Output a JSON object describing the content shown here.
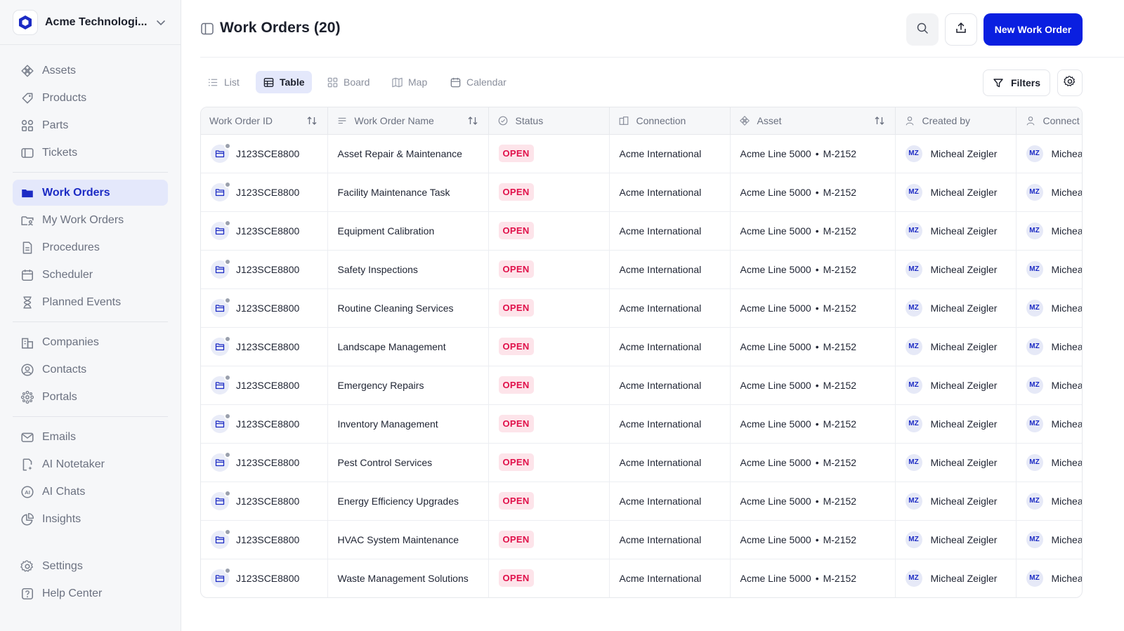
{
  "workspace": {
    "name": "Acme Technologi..."
  },
  "sidebar": {
    "groups": [
      [
        {
          "label": "Assets",
          "icon": "assets-icon"
        },
        {
          "label": "Products",
          "icon": "tag-icon"
        },
        {
          "label": "Parts",
          "icon": "parts-icon"
        },
        {
          "label": "Tickets",
          "icon": "ticket-icon"
        }
      ],
      [
        {
          "label": "Work Orders",
          "icon": "folder-icon",
          "active": true
        },
        {
          "label": "My Work Orders",
          "icon": "user-folder-icon"
        },
        {
          "label": "Procedures",
          "icon": "document-icon"
        },
        {
          "label": "Scheduler",
          "icon": "calendar-icon"
        },
        {
          "label": "Planned Events",
          "icon": "hourglass-icon"
        }
      ],
      [
        {
          "label": "Companies",
          "icon": "building-icon"
        },
        {
          "label": "Contacts",
          "icon": "contact-icon"
        },
        {
          "label": "Portals",
          "icon": "portal-icon"
        }
      ],
      [
        {
          "label": "Emails",
          "icon": "mail-icon"
        },
        {
          "label": "AI Notetaker",
          "icon": "notetaker-icon"
        },
        {
          "label": "AI Chats",
          "icon": "ai-chat-icon"
        },
        {
          "label": "Insights",
          "icon": "pie-chart-icon"
        }
      ],
      [
        {
          "label": "Settings",
          "icon": "gear-icon"
        },
        {
          "label": "Help Center",
          "icon": "help-icon"
        }
      ]
    ]
  },
  "header": {
    "title": "Work Orders (20)",
    "new_button": "New Work Order"
  },
  "views": {
    "tabs": [
      {
        "label": "List",
        "icon": "list-icon"
      },
      {
        "label": "Table",
        "icon": "table-icon",
        "active": true
      },
      {
        "label": "Board",
        "icon": "board-icon"
      },
      {
        "label": "Map",
        "icon": "map-icon"
      },
      {
        "label": "Calendar",
        "icon": "calendar-icon"
      }
    ],
    "filters_label": "Filters"
  },
  "table": {
    "columns": [
      {
        "label": "Work Order ID"
      },
      {
        "label": "Work Order Name"
      },
      {
        "label": "Status"
      },
      {
        "label": "Connection"
      },
      {
        "label": "Asset"
      },
      {
        "label": "Created by"
      },
      {
        "label": "Connect"
      }
    ],
    "rows": [
      {
        "id": "J123SCE8800",
        "name": "Asset Repair & Maintenance",
        "status": "OPEN",
        "connection": "Acme International",
        "asset": "Acme Line 5000",
        "asset_code": "M-2152",
        "creator_initials": "MZ",
        "creator": "Micheal Zeigler",
        "contact_initials": "MZ",
        "contact": "Michea"
      },
      {
        "id": "J123SCE8800",
        "name": "Facility Maintenance Task",
        "status": "OPEN",
        "connection": "Acme International",
        "asset": "Acme Line 5000",
        "asset_code": "M-2152",
        "creator_initials": "MZ",
        "creator": "Micheal Zeigler",
        "contact_initials": "MZ",
        "contact": "Michea"
      },
      {
        "id": "J123SCE8800",
        "name": "Equipment Calibration",
        "status": "OPEN",
        "connection": "Acme International",
        "asset": "Acme Line 5000",
        "asset_code": "M-2152",
        "creator_initials": "MZ",
        "creator": "Micheal Zeigler",
        "contact_initials": "MZ",
        "contact": "Michea"
      },
      {
        "id": "J123SCE8800",
        "name": "Safety Inspections",
        "status": "OPEN",
        "connection": "Acme International",
        "asset": "Acme Line 5000",
        "asset_code": "M-2152",
        "creator_initials": "MZ",
        "creator": "Micheal Zeigler",
        "contact_initials": "MZ",
        "contact": "Michea"
      },
      {
        "id": "J123SCE8800",
        "name": "Routine Cleaning Services",
        "status": "OPEN",
        "connection": "Acme International",
        "asset": "Acme Line 5000",
        "asset_code": "M-2152",
        "creator_initials": "MZ",
        "creator": "Micheal Zeigler",
        "contact_initials": "MZ",
        "contact": "Michea"
      },
      {
        "id": "J123SCE8800",
        "name": "Landscape Management",
        "status": "OPEN",
        "connection": "Acme International",
        "asset": "Acme Line 5000",
        "asset_code": "M-2152",
        "creator_initials": "MZ",
        "creator": "Micheal Zeigler",
        "contact_initials": "MZ",
        "contact": "Michea"
      },
      {
        "id": "J123SCE8800",
        "name": "Emergency Repairs",
        "status": "OPEN",
        "connection": "Acme International",
        "asset": "Acme Line 5000",
        "asset_code": "M-2152",
        "creator_initials": "MZ",
        "creator": "Micheal Zeigler",
        "contact_initials": "MZ",
        "contact": "Michea"
      },
      {
        "id": "J123SCE8800",
        "name": "Inventory Management",
        "status": "OPEN",
        "connection": "Acme International",
        "asset": "Acme Line 5000",
        "asset_code": "M-2152",
        "creator_initials": "MZ",
        "creator": "Micheal Zeigler",
        "contact_initials": "MZ",
        "contact": "Michea"
      },
      {
        "id": "J123SCE8800",
        "name": "Pest Control Services",
        "status": "OPEN",
        "connection": "Acme International",
        "asset": "Acme Line 5000",
        "asset_code": "M-2152",
        "creator_initials": "MZ",
        "creator": "Micheal Zeigler",
        "contact_initials": "MZ",
        "contact": "Michea"
      },
      {
        "id": "J123SCE8800",
        "name": "Energy Efficiency Upgrades",
        "status": "OPEN",
        "connection": "Acme International",
        "asset": "Acme Line 5000",
        "asset_code": "M-2152",
        "creator_initials": "MZ",
        "creator": "Micheal Zeigler",
        "contact_initials": "MZ",
        "contact": "Michea"
      },
      {
        "id": "J123SCE8800",
        "name": "HVAC System Maintenance",
        "status": "OPEN",
        "connection": "Acme International",
        "asset": "Acme Line 5000",
        "asset_code": "M-2152",
        "creator_initials": "MZ",
        "creator": "Micheal Zeigler",
        "contact_initials": "MZ",
        "contact": "Michea"
      },
      {
        "id": "J123SCE8800",
        "name": "Waste Management Solutions",
        "status": "OPEN",
        "connection": "Acme International",
        "asset": "Acme Line 5000",
        "asset_code": "M-2152",
        "creator_initials": "MZ",
        "creator": "Micheal Zeigler",
        "contact_initials": "MZ",
        "contact": "Michea"
      }
    ]
  },
  "colors": {
    "accent": "#0a1fe0",
    "active_nav_bg": "#e4e8fb",
    "status_open": "#e0104a",
    "status_open_bg": "#fde4ea"
  }
}
